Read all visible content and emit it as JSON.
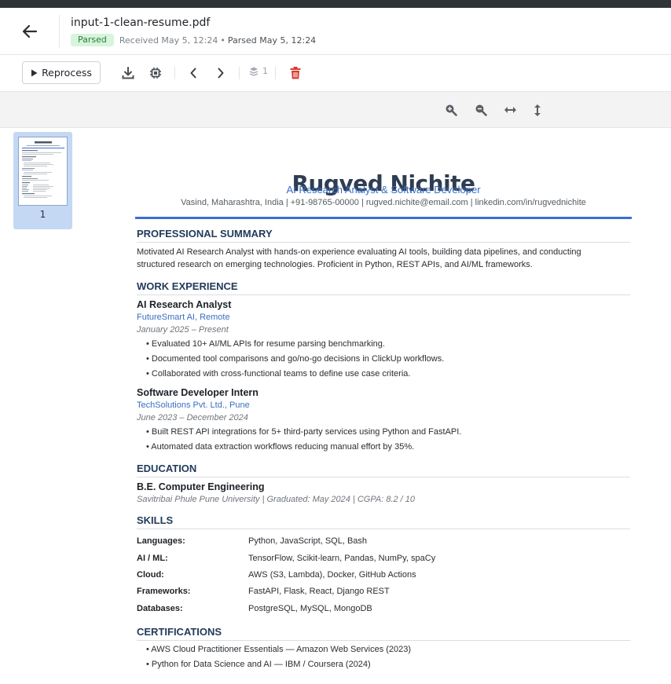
{
  "header": {
    "filename": "input-1-clean-resume.pdf",
    "status": "Parsed",
    "received": "Received May 5, 12:24",
    "separator": "•",
    "parsed": "Parsed May 5, 12:24"
  },
  "toolbar": {
    "reprocess_label": "Reprocess",
    "page_count": "1",
    "icons": [
      "download-icon",
      "chip-icon",
      "chevron-left-icon",
      "chevron-right-icon",
      "pages-icon",
      "trash-icon"
    ],
    "delete_color": "#d93a32"
  },
  "viewer": {
    "icons": [
      "zoom-in-icon",
      "zoom-out-icon",
      "fit-width-icon",
      "fit-height-icon"
    ]
  },
  "thumbnail": {
    "page_number": "1"
  },
  "resume": {
    "name": "Rugved Nichite",
    "headline": "AI Research Analyst & Software Developer",
    "contact": "Vasind, Maharashtra, India | +91-98765-00000 | rugved.nichite@email.com | linkedin.com/in/rugvednichite",
    "sections": {
      "summary_title": "PROFESSIONAL SUMMARY",
      "summary_line1": "Motivated AI Research Analyst with hands-on experience evaluating AI tools, building data pipelines, and conducting",
      "summary_line2": "structured research on emerging technologies. Proficient in Python, REST APIs, and AI/ML frameworks.",
      "work_title": "WORK EXPERIENCE",
      "education_title": "EDUCATION",
      "skills_title": "SKILLS",
      "certs_title": "CERTIFICATIONS"
    },
    "jobs": [
      {
        "title": "AI Research Analyst",
        "company": "FutureSmart AI, Remote",
        "dates": "January 2025 – Present",
        "bullets": [
          "• Evaluated 10+ AI/ML APIs for resume parsing benchmarking.",
          "• Documented tool comparisons and go/no-go decisions in ClickUp workflows.",
          "• Collaborated with cross-functional teams to define use case criteria."
        ]
      },
      {
        "title": "Software Developer Intern",
        "company": "TechSolutions Pvt. Ltd., Pune",
        "dates": "June 2023 – December 2024",
        "bullets": [
          "• Built REST API integrations for 5+ third-party services using Python and FastAPI.",
          "• Automated data extraction workflows reducing manual effort by 35%."
        ]
      }
    ],
    "education": {
      "degree": "B.E. Computer Engineering",
      "details": "Savitribai Phule Pune University | Graduated: May 2024 | CGPA: 8.2 / 10"
    },
    "skills": [
      {
        "key": "Languages:",
        "value": "Python, JavaScript, SQL, Bash"
      },
      {
        "key": "AI / ML:",
        "value": "TensorFlow, Scikit-learn, Pandas, NumPy, spaCy"
      },
      {
        "key": "Cloud:",
        "value": "AWS (S3, Lambda), Docker, GitHub Actions"
      },
      {
        "key": "Frameworks:",
        "value": "FastAPI, Flask, React, Django REST"
      },
      {
        "key": "Databases:",
        "value": "PostgreSQL, MySQL, MongoDB"
      }
    ],
    "certifications": [
      "• AWS Cloud Practitioner Essentials — Amazon Web Services (2023)",
      "• Python for Data Science and AI — IBM / Coursera (2024)"
    ]
  }
}
